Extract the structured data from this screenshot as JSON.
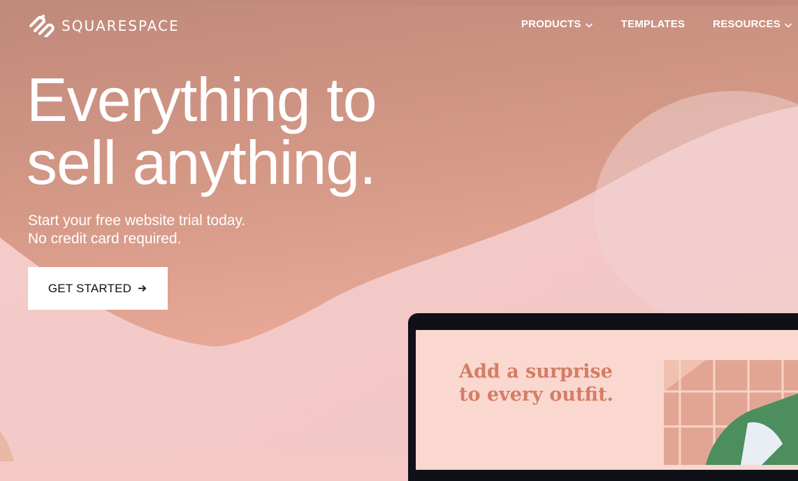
{
  "brand": {
    "name": "SQUARESPACE"
  },
  "nav": {
    "items": [
      {
        "label": "PRODUCTS",
        "has_dropdown": true
      },
      {
        "label": "TEMPLATES",
        "has_dropdown": false
      },
      {
        "label": "RESOURCES",
        "has_dropdown": true
      }
    ]
  },
  "hero": {
    "title_line1": "Everything to",
    "title_line2": "sell anything.",
    "subtitle_line1": "Start your free website trial today.",
    "subtitle_line2": "No credit card required.",
    "cta_label": "GET STARTED"
  },
  "preview": {
    "headline_line1": "Add a surprise",
    "headline_line2": "to every outfit."
  },
  "colors": {
    "terracotta": "#c98a78",
    "blush": "#f4c9c6",
    "promo_text": "#d47d65",
    "laptop_bezel": "#101018"
  },
  "icons": [
    "squarespace-logo-icon",
    "chevron-down-icon",
    "arrow-right-icon"
  ]
}
